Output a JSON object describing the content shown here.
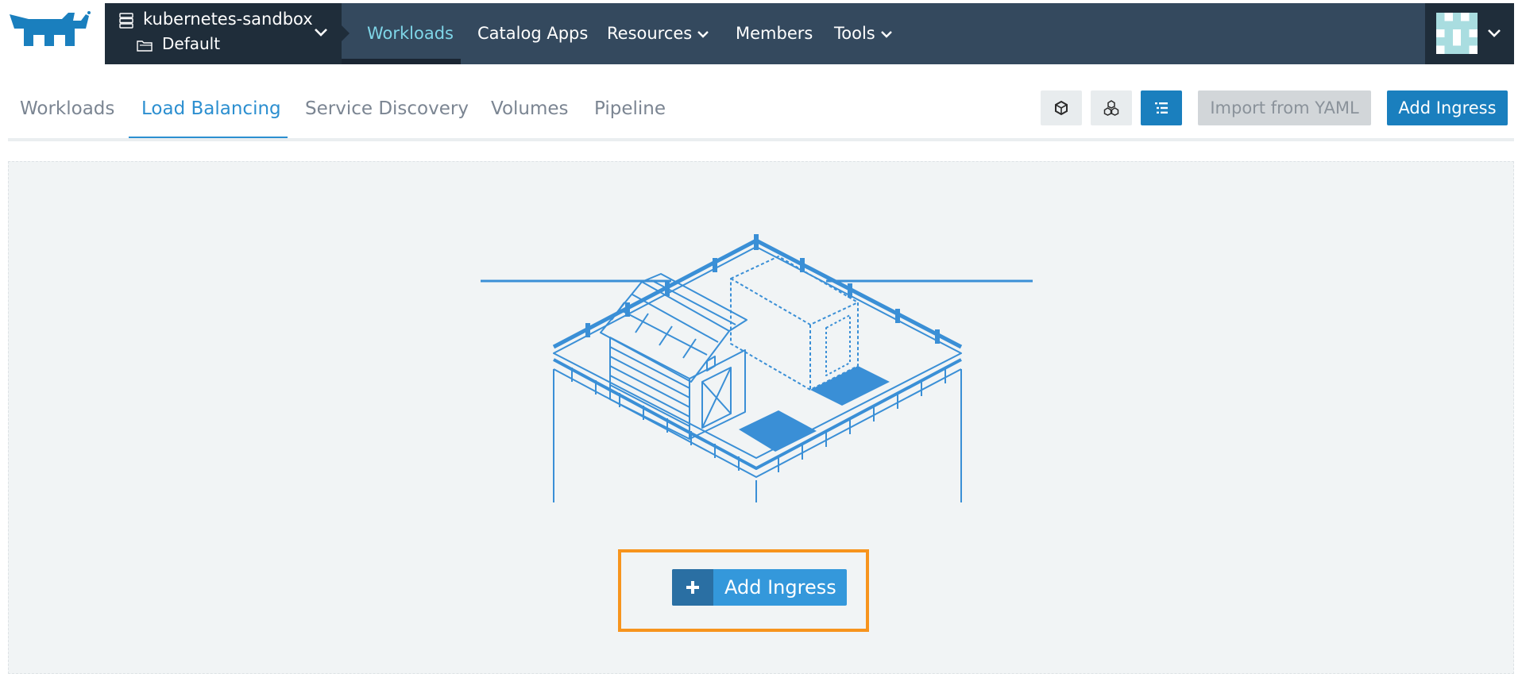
{
  "header": {
    "cluster_name": "kubernetes-sandbox",
    "project_name": "Default",
    "nav": [
      {
        "label": "Workloads",
        "active": true
      },
      {
        "label": "Catalog Apps"
      },
      {
        "label": "Resources",
        "has_dropdown": true
      },
      {
        "label": "Members"
      },
      {
        "label": "Tools",
        "has_dropdown": true
      }
    ]
  },
  "subtabs": [
    {
      "label": "Workloads"
    },
    {
      "label": "Load Balancing",
      "active": true
    },
    {
      "label": "Service Discovery"
    },
    {
      "label": "Volumes"
    },
    {
      "label": "Pipeline"
    }
  ],
  "toolbar": {
    "view_buttons": [
      "cube-icon",
      "cluster-icon",
      "list-icon"
    ],
    "import_label": "Import from YAML",
    "add_label": "Add Ingress"
  },
  "empty_state": {
    "add_label": "Add Ingress"
  },
  "colors": {
    "topbar": "#34495e",
    "accent": "#2c8fd0",
    "button": "#1a7fbe",
    "highlight": "#f7941d",
    "illustration": "#3a8fd6"
  }
}
